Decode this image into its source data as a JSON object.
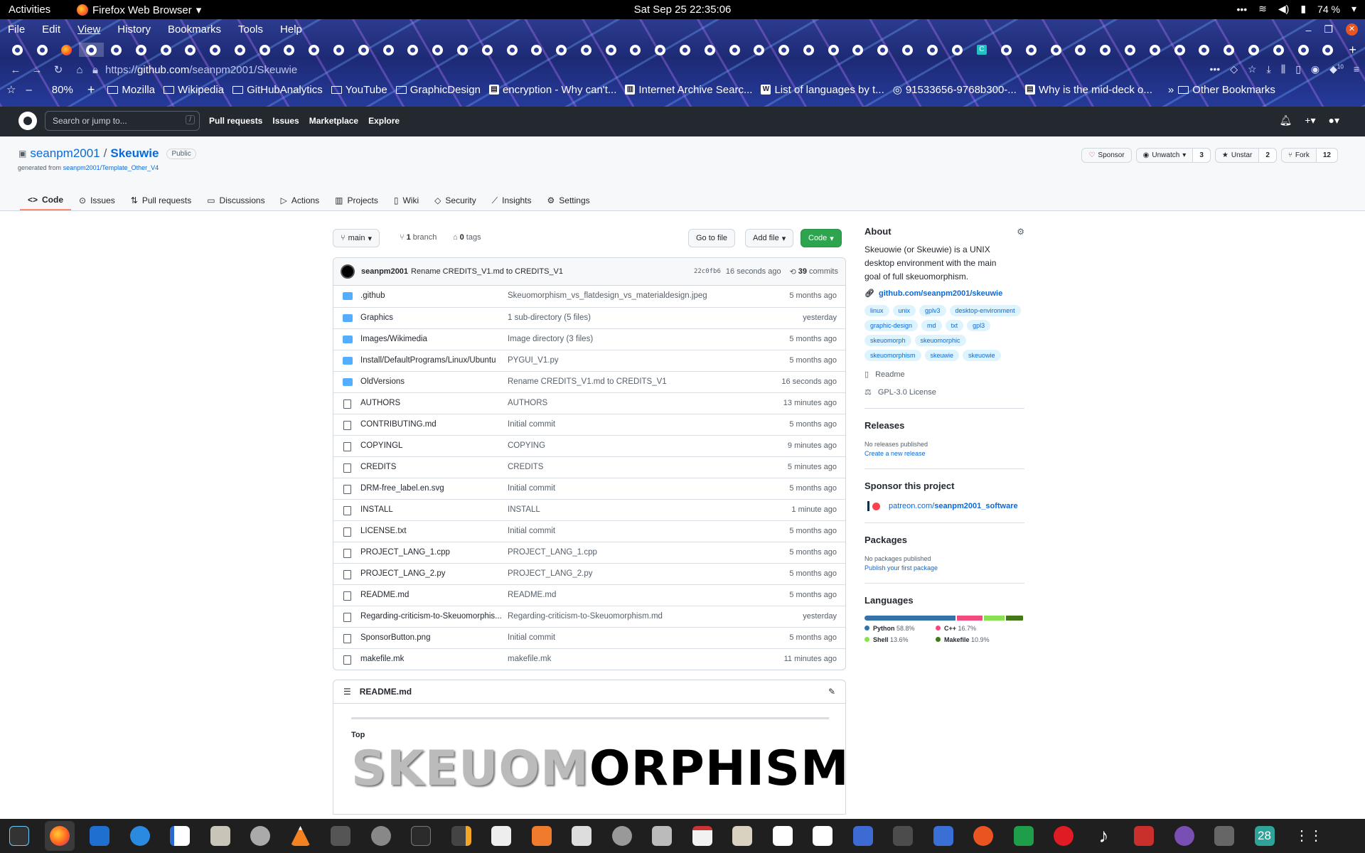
{
  "gnome": {
    "activities": "Activities",
    "app": "Firefox Web Browser",
    "clock": "Sat Sep 25  22:35:06",
    "battery": "74 %"
  },
  "firefox": {
    "menu": [
      "File",
      "Edit",
      "View",
      "History",
      "Bookmarks",
      "Tools",
      "Help"
    ],
    "url_scheme": "https://",
    "url_host": "github.com",
    "url_path": "/seanpm2001/Skeuwie",
    "zoom": "80%",
    "badge": "10",
    "bookmarks": [
      {
        "label": "Mozilla",
        "kind": "folder"
      },
      {
        "label": "Wikipedia",
        "kind": "folder"
      },
      {
        "label": "GitHubAnalytics",
        "kind": "folder"
      },
      {
        "label": "YouTube",
        "kind": "folder"
      },
      {
        "label": "GraphicDesign",
        "kind": "folder"
      },
      {
        "label": "encryption - Why can't...",
        "kind": "site"
      },
      {
        "label": "Internet Archive Searc...",
        "kind": "site"
      },
      {
        "label": "List of languages by t...",
        "kind": "site"
      },
      {
        "label": "91533656-9768b300-...",
        "kind": "site"
      },
      {
        "label": "Why is the mid-deck o...",
        "kind": "site"
      }
    ],
    "other_bookmarks": "Other Bookmarks"
  },
  "github": {
    "search_placeholder": "Search or jump to...",
    "search_key": "/",
    "nav": [
      "Pull requests",
      "Issues",
      "Marketplace",
      "Explore"
    ]
  },
  "repo": {
    "owner": "seanpm2001",
    "name": "Skeuwie",
    "visibility": "Public",
    "generated_prefix": "generated from",
    "generated_from": "seanpm2001/Template_Other_V4",
    "sponsor": "Sponsor",
    "unwatch": "Unwatch",
    "watch_count": "3",
    "unstar": "Unstar",
    "star_count": "2",
    "fork": "Fork",
    "fork_count": "12",
    "tabs": [
      "Code",
      "Issues",
      "Pull requests",
      "Discussions",
      "Actions",
      "Projects",
      "Wiki",
      "Security",
      "Insights",
      "Settings"
    ],
    "branch": "main",
    "branch_count": "1",
    "branch_word": "branch",
    "tag_count": "0",
    "tag_word": "tags",
    "go_to_file": "Go to file",
    "add_file": "Add file",
    "code": "Code",
    "commit_author": "seanpm2001",
    "commit_message": "Rename CREDITS_V1.md to CREDITS_V1",
    "commit_sha": "22c0fb6",
    "commit_age": "16 seconds ago",
    "commit_count": "39",
    "commit_word": "commits",
    "files": [
      {
        "type": "dir",
        "name": ".github",
        "msg": "Skeuomorphism_vs_flatdesign_vs_materialdesign.jpeg",
        "age": "5 months ago"
      },
      {
        "type": "dir",
        "name": "Graphics",
        "msg": "1 sub-directory (5 files)",
        "age": "yesterday"
      },
      {
        "type": "dir",
        "name": "Images/Wikimedia",
        "msg": "Image directory (3 files)",
        "age": "5 months ago"
      },
      {
        "type": "dir",
        "name": "Install/DefaultPrograms/Linux/Ubuntu",
        "msg": "PYGUI_V1.py",
        "age": "5 months ago"
      },
      {
        "type": "dir",
        "name": "OldVersions",
        "msg": "Rename CREDITS_V1.md to CREDITS_V1",
        "age": "16 seconds ago"
      },
      {
        "type": "file",
        "name": "AUTHORS",
        "msg": "AUTHORS",
        "age": "13 minutes ago"
      },
      {
        "type": "file",
        "name": "CONTRIBUTING.md",
        "msg": "Initial commit",
        "age": "5 months ago"
      },
      {
        "type": "file",
        "name": "COPYINGL",
        "msg": "COPYING",
        "age": "9 minutes ago"
      },
      {
        "type": "file",
        "name": "CREDITS",
        "msg": "CREDITS",
        "age": "5 minutes ago"
      },
      {
        "type": "file",
        "name": "DRM-free_label.en.svg",
        "msg": "Initial commit",
        "age": "5 months ago"
      },
      {
        "type": "file",
        "name": "INSTALL",
        "msg": "INSTALL",
        "age": "1 minute ago"
      },
      {
        "type": "file",
        "name": "LICENSE.txt",
        "msg": "Initial commit",
        "age": "5 months ago"
      },
      {
        "type": "file",
        "name": "PROJECT_LANG_1.cpp",
        "msg": "PROJECT_LANG_1.cpp",
        "age": "5 months ago"
      },
      {
        "type": "file",
        "name": "PROJECT_LANG_2.py",
        "msg": "PROJECT_LANG_2.py",
        "age": "5 months ago"
      },
      {
        "type": "file",
        "name": "README.md",
        "msg": "README.md",
        "age": "5 months ago"
      },
      {
        "type": "file",
        "name": "Regarding-criticism-to-Skeuomorphis...",
        "msg": "Regarding-criticism-to-Skeuomorphism.md",
        "age": "yesterday"
      },
      {
        "type": "file",
        "name": "SponsorButton.png",
        "msg": "Initial commit",
        "age": "5 months ago"
      },
      {
        "type": "file",
        "name": "makefile.mk",
        "msg": "makefile.mk",
        "age": "11 minutes ago"
      }
    ],
    "readme_title": "README.md",
    "readme_top": "Top",
    "readme_banner_light": "SKEUOM",
    "readme_banner_dark": "ORPHISM"
  },
  "about": {
    "heading": "About",
    "description": "Skeuowie (or Skeuwie) is a UNIX desktop environment with the main goal of full skeuomorphism.",
    "link": "github.com/seanpm2001/skeuwie",
    "topics": [
      "linux",
      "unix",
      "gplv3",
      "desktop-environment",
      "graphic-design",
      "md",
      "txt",
      "gpl3",
      "skeuomorph",
      "skeuomorphic",
      "skeuomorphism",
      "skeuwie",
      "skeuowie"
    ],
    "readme": "Readme",
    "license": "GPL-3.0 License",
    "releases_heading": "Releases",
    "releases_none": "No releases published",
    "releases_create": "Create a new release",
    "sponsor_heading": "Sponsor this project",
    "sponsor_link_prefix": "patreon.com/",
    "sponsor_link_user": "seanpm2001_software",
    "packages_heading": "Packages",
    "packages_none": "No packages published",
    "packages_publish": "Publish your first package",
    "languages_heading": "Languages",
    "languages": [
      {
        "name": "Python",
        "percent": "58.8%",
        "value": 58.8,
        "color": "#3572A5"
      },
      {
        "name": "C++",
        "percent": "16.7%",
        "value": 16.7,
        "color": "#f34b7d"
      },
      {
        "name": "Shell",
        "percent": "13.6%",
        "value": 13.6,
        "color": "#89e051"
      },
      {
        "name": "Makefile",
        "percent": "10.9%",
        "value": 10.9,
        "color": "#427819"
      }
    ]
  },
  "dock": {
    "calendar_day": "28"
  }
}
